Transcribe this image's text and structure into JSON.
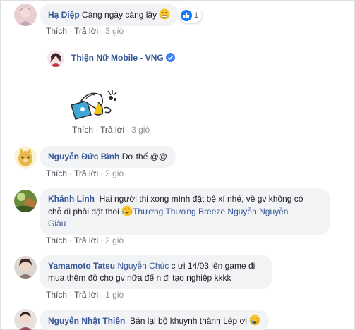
{
  "actions": {
    "like": "Thích",
    "reply": "Trả lời",
    "sep": "·"
  },
  "comments": [
    {
      "name": "Hạ Diệp",
      "text": "Càng ngày càng lầy",
      "reaction_count": "1",
      "time": "3 giờ"
    },
    {
      "name": "Thiện Nữ Mobile - VNG",
      "time": "3 giờ"
    },
    {
      "name": "Nguyễn Đức Bình",
      "text": "Dơ thế @@",
      "time": "2 giờ"
    },
    {
      "name": "Khánh Linh",
      "text_line1": "Hai người thi xong mình đặt bệ xí nhé, về gv không có",
      "text_line2": "chỗ đi phải đặt thoi",
      "mention_line2": "Thương Thương Breeze Nguyễn Nguyễn",
      "mention_line3": "Giàu",
      "time": "2 giờ"
    },
    {
      "name": "Yamamoto Tatsu",
      "mention": "Nguyễn Chúc",
      "text_line1": "c ưi 14/03 lên game đi",
      "text_line2": "mua thêm đồ cho gv nữa để n đi tạo nghiệp kkkk",
      "time": "1 giờ"
    },
    {
      "name": "Nguyễn Nhật Thiên",
      "text": "Bán lại bộ khuynh thành Lép ơi"
    }
  ],
  "colors": {
    "name": "#385898",
    "bubble": "#f2f3f5",
    "like_blue": "#1877f2"
  }
}
